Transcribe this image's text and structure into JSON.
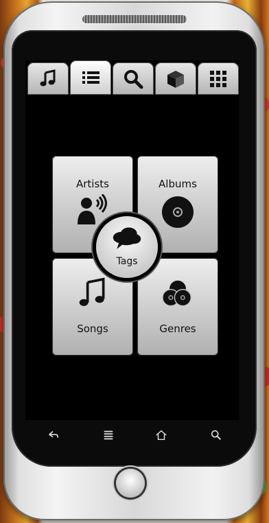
{
  "tabs": [
    {
      "icon": "music-note-icon",
      "active": false
    },
    {
      "icon": "list-icon",
      "active": true
    },
    {
      "icon": "search-icon",
      "active": false
    },
    {
      "icon": "cube-icon",
      "active": false
    },
    {
      "icon": "grid-icon",
      "active": false
    }
  ],
  "tiles": {
    "artists": {
      "label": "Artists",
      "icon": "artist-person-icon"
    },
    "albums": {
      "label": "Albums",
      "icon": "disc-icon"
    },
    "songs": {
      "label": "Songs",
      "icon": "music-note-icon"
    },
    "genres": {
      "label": "Genres",
      "icon": "genres-icon"
    },
    "tags": {
      "label": "Tags",
      "icon": "cloud-tags-icon"
    }
  },
  "navbar": [
    "back-icon",
    "menu-icon",
    "home-icon",
    "search-icon"
  ],
  "colors": {
    "screen_bg": "#000000",
    "tile_light": "#eeeeee",
    "tile_dark": "#b0b0b0"
  }
}
